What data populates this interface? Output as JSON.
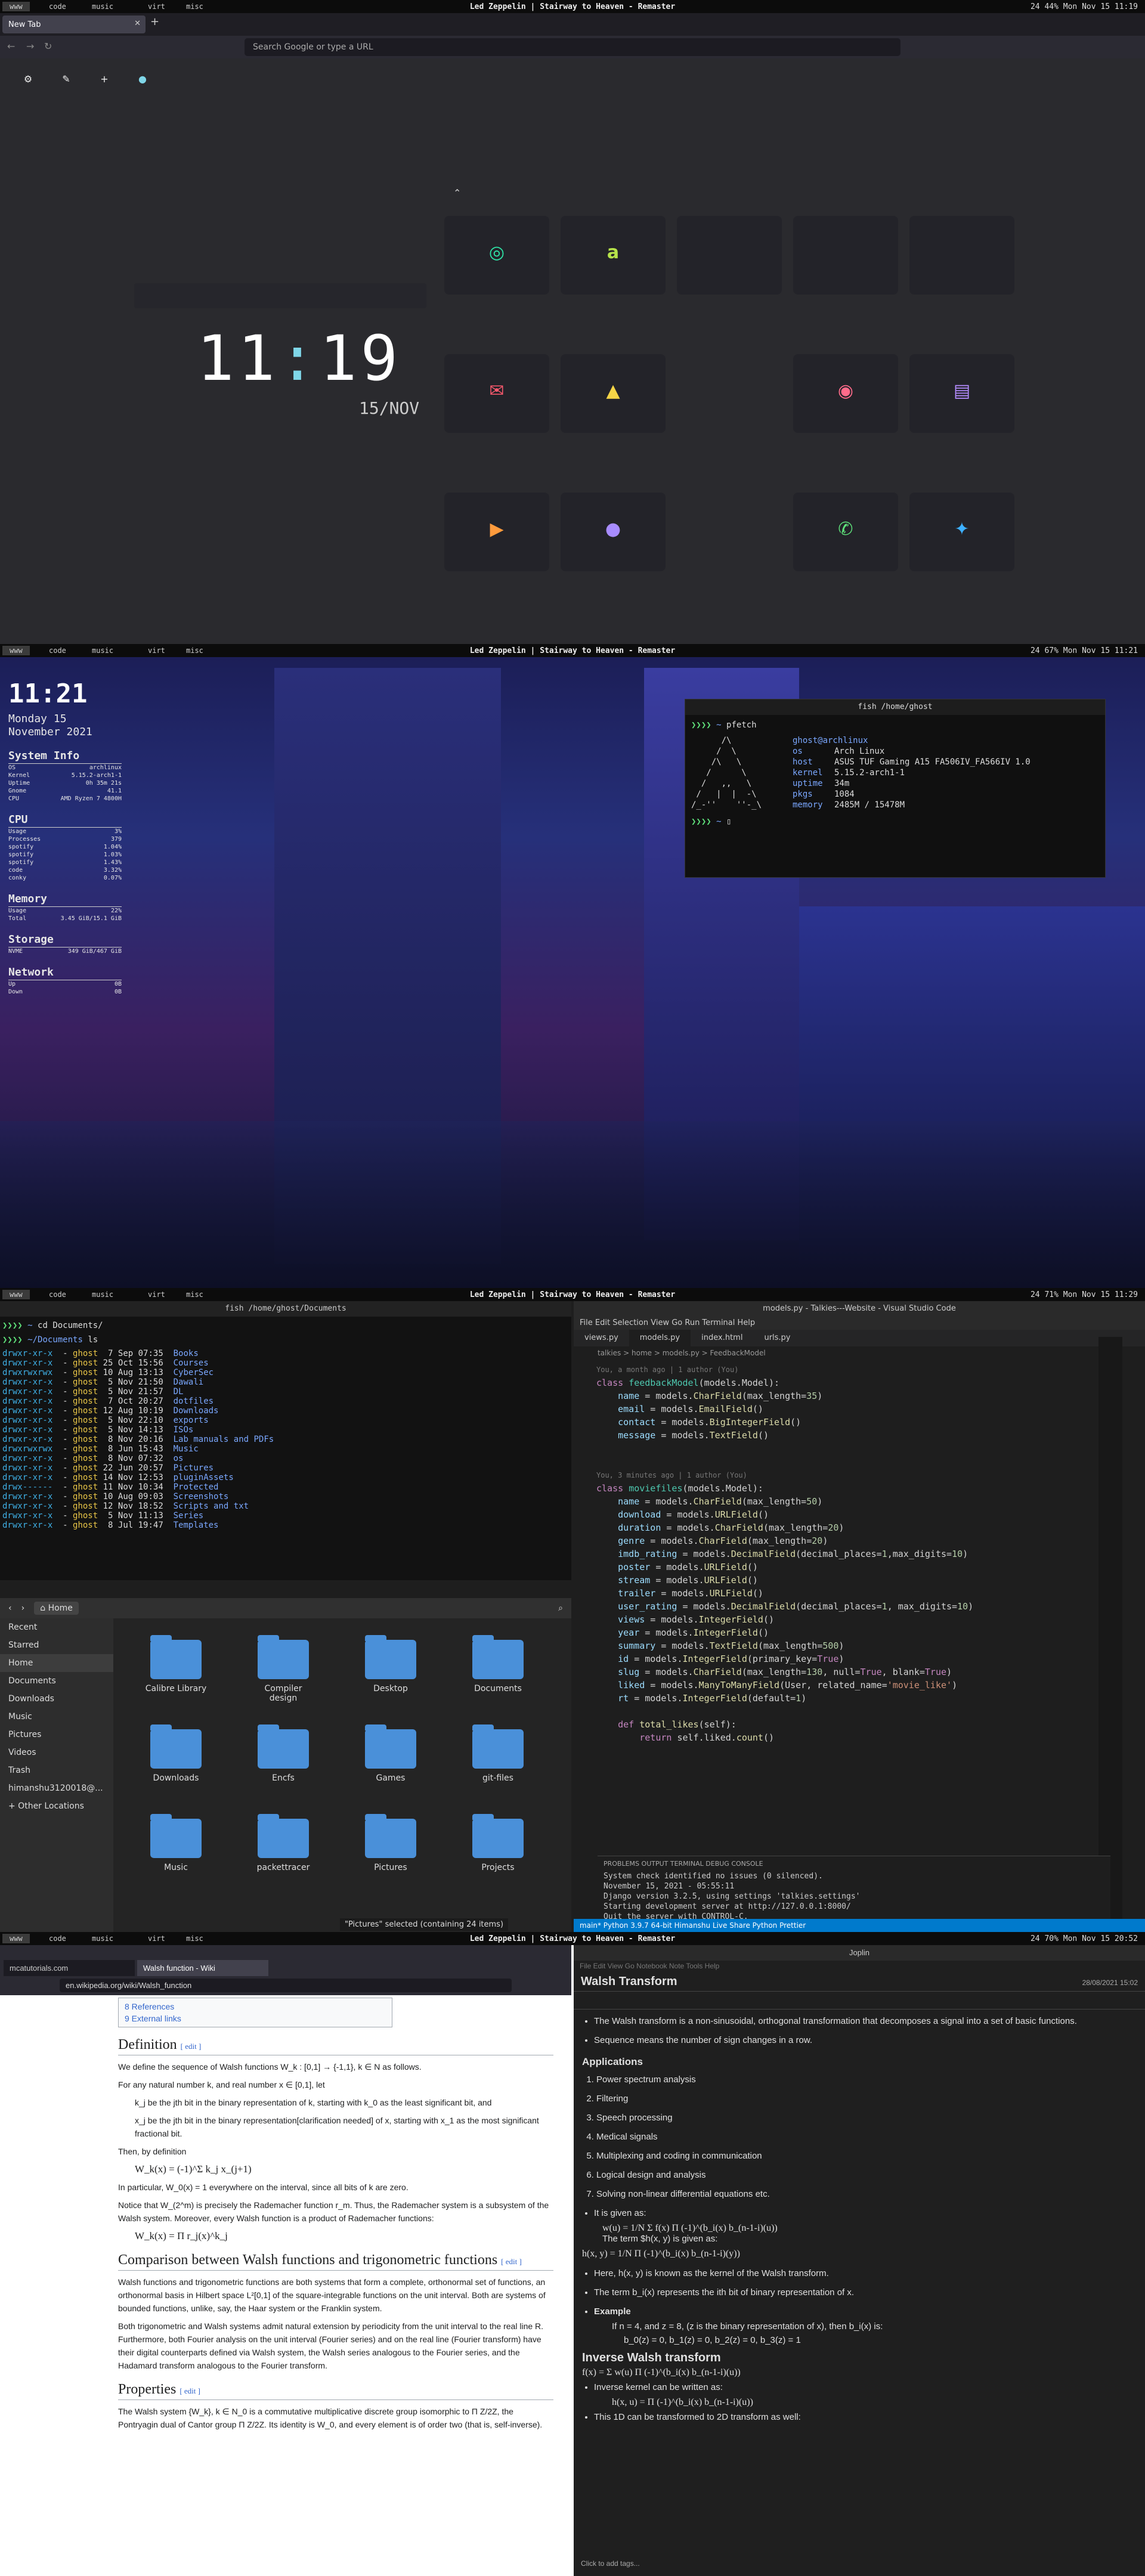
{
  "bar": {
    "ws": [
      "www",
      "code",
      "music",
      "virt",
      "misc"
    ],
    "title": "Led Zeppelin | Stairway to Heaven - Remaster",
    "right1": "24   44%   Mon Nov 15 11:19",
    "right2": "24   67%   Mon Nov 15 11:21",
    "right3": "24   71%   Mon Nov 15 11:29",
    "right4": "24   70%   Mon Nov 15 20:52"
  },
  "firefox": {
    "tab": "New Tab",
    "url": "Search Google or type a URL",
    "clock_h": "11",
    "clock_sep": ":",
    "clock_m": "19",
    "date": "15/NOV"
  },
  "tiles": [
    "instagram-icon",
    "amazon-icon",
    "gmail-icon",
    "drive-icon",
    "reddit-icon",
    "film-icon",
    "youtube-icon",
    "github-icon",
    "whatsapp-icon",
    "twitter-icon"
  ],
  "conky": {
    "time": "11:21",
    "day": "Monday 15",
    "month": "November 2021",
    "sys": "System Info",
    "rows": [
      [
        "OS",
        "archlinux"
      ],
      [
        "Kernel",
        "5.15.2-arch1-1"
      ],
      [
        "Uptime",
        "0h 35m 21s"
      ],
      [
        "Gnome",
        "41.1"
      ],
      [
        "CPU",
        "AMD Ryzen 7 4800H"
      ]
    ],
    "cpu": "CPU",
    "cpurows": [
      [
        "Usage",
        "3%"
      ],
      [
        "Processes",
        "379"
      ],
      [
        "spotify",
        "1.04%"
      ],
      [
        "spotify",
        "1.03%"
      ],
      [
        "spotify",
        "1.43%"
      ],
      [
        "code",
        "3.32%"
      ],
      [
        "conky",
        "0.07%"
      ]
    ],
    "mem": "Memory",
    "memrows": [
      [
        "Usage",
        "22%"
      ],
      [
        "Total",
        "3.45 GiB/15.1 GiB"
      ]
    ],
    "stor": "Storage",
    "storrows": [
      [
        "NVME",
        "349 GiB/467 GiB"
      ]
    ],
    "net": "Network",
    "netrows": [
      [
        "Up",
        "0B"
      ],
      [
        "Down",
        "0B"
      ]
    ]
  },
  "term1": {
    "title": "fish /home/ghost",
    "cmd": "pfetch",
    "user": "ghost@archlinux",
    "info": [
      [
        "os",
        "Arch Linux"
      ],
      [
        "host",
        "ASUS TUF Gaming A15 FA506IV_FA566IV 1.0"
      ],
      [
        "kernel",
        "5.15.2-arch1-1"
      ],
      [
        "uptime",
        "34m"
      ],
      [
        "pkgs",
        "1084"
      ],
      [
        "memory",
        "2485M / 15478M"
      ]
    ]
  },
  "term2": {
    "title": "fish /home/ghost/Documents",
    "cmd1": "cd Documents/",
    "prompt": "~/Documents",
    "cmd2": "ls",
    "entries": [
      [
        "drwxr-xr-x",
        "7 Sep 07:35",
        "Books"
      ],
      [
        "drwxr-xr-x",
        "25 Oct 15:56",
        "Courses"
      ],
      [
        "drwxrwxrwx",
        "10 Aug 13:13",
        "CyberSec"
      ],
      [
        "drwxr-xr-x",
        "5 Nov 21:50",
        "Dawali"
      ],
      [
        "drwxr-xr-x",
        "5 Nov 21:57",
        "DL"
      ],
      [
        "drwxr-xr-x",
        "7 Oct 20:27",
        "dotfiles"
      ],
      [
        "drwxr-xr-x",
        "12 Aug 10:19",
        "Downloads"
      ],
      [
        "drwxr-xr-x",
        "5 Nov 22:10",
        "exports"
      ],
      [
        "drwxr-xr-x",
        "5 Nov 14:13",
        "ISOs"
      ],
      [
        "drwxr-xr-x",
        "8 Nov 20:16",
        "Lab manuals and PDFs"
      ],
      [
        "drwxrwxrwx",
        "8 Jun 15:43",
        "Music"
      ],
      [
        "drwxr-xr-x",
        "8 Nov 07:32",
        "os"
      ],
      [
        "drwxr-xr-x",
        "22 Jun 20:57",
        "Pictures"
      ],
      [
        "drwxr-xr-x",
        "14 Nov 12:53",
        "pluginAssets"
      ],
      [
        "drwx------",
        "11 Nov 10:34",
        "Protected"
      ],
      [
        "drwxr-xr-x",
        "10 Aug 09:03",
        "Screenshots"
      ],
      [
        "drwxr-xr-x",
        "12 Nov 18:52",
        "Scripts and txt"
      ],
      [
        "drwxr-xr-x",
        "5 Nov 11:13",
        "Series"
      ],
      [
        "drwxr-xr-x",
        "8 Jul 19:47",
        "Templates"
      ]
    ]
  },
  "files": {
    "path": "Home",
    "side": [
      "Recent",
      "Starred",
      "Home",
      "Documents",
      "Downloads",
      "Music",
      "Pictures",
      "Videos",
      "Trash",
      "himanshu3120018@...",
      "+ Other Locations"
    ],
    "folders": [
      "Calibre Library",
      "Compiler design",
      "Desktop",
      "Documents",
      "Downloads",
      "Encfs",
      "Games",
      "git-files",
      "Music",
      "packettracer",
      "Pictures",
      "Projects"
    ],
    "status": "\"Pictures\" selected (containing 24 items)"
  },
  "vscode": {
    "title": "models.py - Talkies---Website - Visual Studio Code",
    "menu": "File Edit Selection View Go Run Terminal Help",
    "tabs": [
      "views.py",
      "models.py",
      "index.html",
      "urls.py"
    ],
    "crumb": "talkies > home > models.py > FeedbackModel",
    "blame1": "You, a month ago | 1 author (You)",
    "blame2": "You, 3 minutes ago | 1 author (You)",
    "termtabs": "PROBLEMS   OUTPUT   TERMINAL   DEBUG CONSOLE",
    "termlines": [
      "System check identified no issues (0 silenced).",
      "November 15, 2021 - 05:55:11",
      "Django version 3.2.5, using settings 'talkies.settings'",
      "Starting development server at http://127.0.0.1:8000/",
      "Quit the server with CONTROL-C."
    ],
    "status": "main*   Python 3.9.7 64-bit   Himanshu   Live Share   Python   Prettier"
  },
  "wiki": {
    "tab1": "mcatutorials.com",
    "tab2": "Walsh function - Wiki",
    "url": "en.wikipedia.org/wiki/Walsh_function",
    "toc": [
      "8 References",
      "9 External links"
    ],
    "h_def": "Definition",
    "h_cmp": "Comparison between Walsh functions and trigonometric functions",
    "h_prop": "Properties",
    "edit": "[ edit ]",
    "p1": "We define the sequence of Walsh functions W_k : [0,1] → {-1,1}, k ∈ N as follows.",
    "p2": "For any natural number k, and real number x ∈ [0,1], let",
    "p3": "k_j be the jth bit in the binary representation of k, starting with k_0 as the least significant bit, and",
    "p4": "x_j be the jth bit in the binary representation[clarification needed] of x, starting with x_1 as the most significant fractional bit.",
    "p5": "Then, by definition",
    "f1": "W_k(x) = (-1)^Σ k_j x_(j+1)",
    "p6": "In particular, W_0(x) = 1 everywhere on the interval, since all bits of k are zero.",
    "p7": "Notice that W_(2^m) is precisely the Rademacher function r_m. Thus, the Rademacher system is a subsystem of the Walsh system. Moreover, every Walsh function is a product of Rademacher functions:",
    "f2": "W_k(x) = Π r_j(x)^k_j",
    "p8": "Walsh functions and trigonometric functions are both systems that form a complete, orthonormal set of functions, an orthonormal basis in Hilbert space L²[0,1] of the square-integrable functions on the unit interval. Both are systems of bounded functions, unlike, say, the Haar system or the Franklin system.",
    "p9": "Both trigonometric and Walsh systems admit natural extension by periodicity from the unit interval to the real line R. Furthermore, both Fourier analysis on the unit interval (Fourier series) and on the real line (Fourier transform) have their digital counterparts defined via Walsh system, the Walsh series analogous to the Fourier series, and the Hadamard transform analogous to the Fourier transform.",
    "p10": "The Walsh system {W_k}, k ∈ N_0 is a commutative multiplicative discrete group isomorphic to Π Z/2Z, the Pontryagin dual of Cantor group Π Z/2Z. Its identity is W_0, and every element is of order two (that is, self-inverse)."
  },
  "joplin": {
    "title": "Joplin",
    "menu": "File Edit View Go Notebook Note Tools Help",
    "note": "Walsh Transform",
    "date": "28/08/2021 15:02",
    "b1": "The Walsh transform is a non-sinusoidal, orthogonal transformation that decomposes a signal into a set of basic functions.",
    "b2": "Sequence means the number of sign changes in a row.",
    "h_app": "Applications",
    "apps": [
      "Power spectrum analysis",
      "Filtering",
      "Speech processing",
      "Medical signals",
      "Multiplexing and coding in communication",
      "Logical design and analysis",
      "Solving non-linear differential equations etc."
    ],
    "given": "It is given as:",
    "term": "The term $h(x, y) is given as:",
    "f1": "w(u) = 1/N Σ f(x) Π (-1)^(b_i(x) b_(n-1-i)(u))",
    "f2": "h(x, y) = 1/N Π (-1)^(b_i(x) b_(n-1-i)(y))",
    "k1": "Here, h(x, y) is known as the kernel of the Walsh transform.",
    "k2": "The term b_i(x) represents the ith bit of binary representation of x.",
    "ex": "Example",
    "ex1": "If n = 4, and z = 8, (z is the binary representation of x), then b_i(x) is:",
    "ex2": "b_0(z) = 0, b_1(z) = 0, b_2(z) = 0, b_3(z) = 1",
    "h_inv": "Inverse Walsh transform",
    "f3": "f(x) = Σ w(u) Π (-1)^(b_i(x) b_(n-1-i)(u))",
    "inv": "Inverse kernel can be written as:",
    "f4": "h(x, u) = Π (-1)^(b_i(x) b_(n-1-i)(u))",
    "two": "This 1D can be transformed to 2D transform as well:",
    "tags": "Click to add tags..."
  }
}
